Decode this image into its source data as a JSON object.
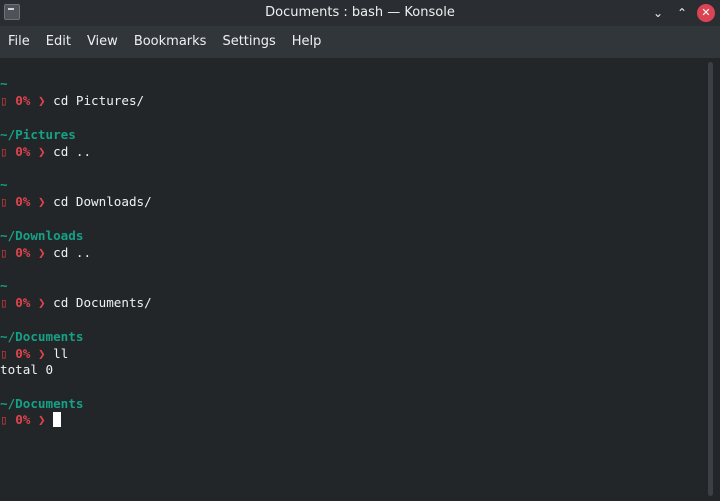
{
  "window": {
    "title": "Documents : bash — Konsole",
    "controls": {
      "minimize": "⌄",
      "maximize": "⌃",
      "close": "✕"
    }
  },
  "menu": [
    "File",
    "Edit",
    "View",
    "Bookmarks",
    "Settings",
    "Help"
  ],
  "prompt": {
    "status_icon": "▯",
    "percent": "0%",
    "chevron": "❯"
  },
  "terminal": {
    "blocks": [
      {
        "dir": "~",
        "command": "cd Pictures/"
      },
      {
        "dir": "~/Pictures",
        "command": "cd .."
      },
      {
        "dir": "~",
        "command": "cd Downloads/"
      },
      {
        "dir": "~/Downloads",
        "command": "cd .."
      },
      {
        "dir": "~",
        "command": "cd Documents/"
      },
      {
        "dir": "~/Documents",
        "command": "ll",
        "output": "total 0"
      },
      {
        "dir": "~/Documents",
        "command": ""
      }
    ]
  },
  "colors": {
    "directory": "#16a085",
    "prompt_status": "#e0444e",
    "close_button": "#da4453",
    "terminal_bg": "#232629"
  }
}
